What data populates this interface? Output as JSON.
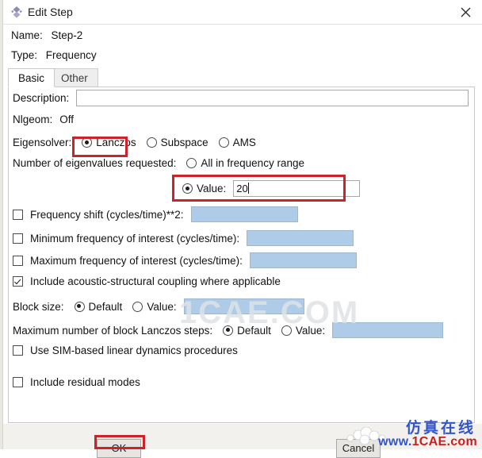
{
  "window": {
    "title": "Edit Step",
    "icon": "abaqus-step-icon",
    "close_label": "close-icon"
  },
  "header": {
    "name_label": "Name:",
    "name_value": "Step-2",
    "type_label": "Type:",
    "type_value": "Frequency"
  },
  "tabs": [
    {
      "label": "Basic",
      "active": true
    },
    {
      "label": "Other",
      "active": false
    }
  ],
  "form": {
    "description_label": "Description:",
    "description_value": "",
    "nlgeom_label": "Nlgeom:",
    "nlgeom_value": "Off",
    "eigensolver_label": "Eigensolver:",
    "eigensolver_options": [
      {
        "label": "Lanczos",
        "selected": true
      },
      {
        "label": "Subspace",
        "selected": false
      },
      {
        "label": "AMS",
        "selected": false
      }
    ],
    "num_eigen_label": "Number of eigenvalues requested:",
    "num_eigen_all_label": "All in frequency range",
    "num_eigen_all_selected": false,
    "num_eigen_value_label": "Value:",
    "num_eigen_value_selected": true,
    "num_eigen_value": "20",
    "freq_shift_label": "Frequency shift (cycles/time)**2:",
    "freq_shift_checked": false,
    "freq_shift_value": "",
    "min_freq_label": "Minimum frequency of interest (cycles/time):",
    "min_freq_checked": false,
    "min_freq_value": "",
    "max_freq_label": "Maximum frequency of interest (cycles/time):",
    "max_freq_checked": false,
    "max_freq_value": "",
    "acoustic_label": "Include acoustic-structural coupling where applicable",
    "acoustic_checked": true,
    "block_size_label": "Block size:",
    "block_size_default_label": "Default",
    "block_size_default_selected": true,
    "block_size_value_label": "Value:",
    "block_size_value_selected": false,
    "block_size_value": "",
    "max_steps_label": "Maximum number of block Lanczos steps:",
    "max_steps_default_label": "Default",
    "max_steps_default_selected": true,
    "max_steps_value_label": "Value:",
    "max_steps_value_selected": false,
    "max_steps_value": "",
    "sim_label": "Use SIM-based linear dynamics procedures",
    "sim_checked": false,
    "residual_label": "Include residual modes",
    "residual_checked": false
  },
  "footer": {
    "ok_label": "OK",
    "cancel_label": "Cancel"
  },
  "watermarks": {
    "background": "1CAE.COM",
    "corner_cn": "仿真在线",
    "corner_url_prefix": "www.",
    "corner_url_main": "1CAE",
    "corner_url_suffix": ".com"
  },
  "annotations": {
    "accent_color": "#cc2229",
    "boxes": [
      "eigensolver-lanczos",
      "num-eigenvalues-value",
      "ok-button"
    ]
  }
}
